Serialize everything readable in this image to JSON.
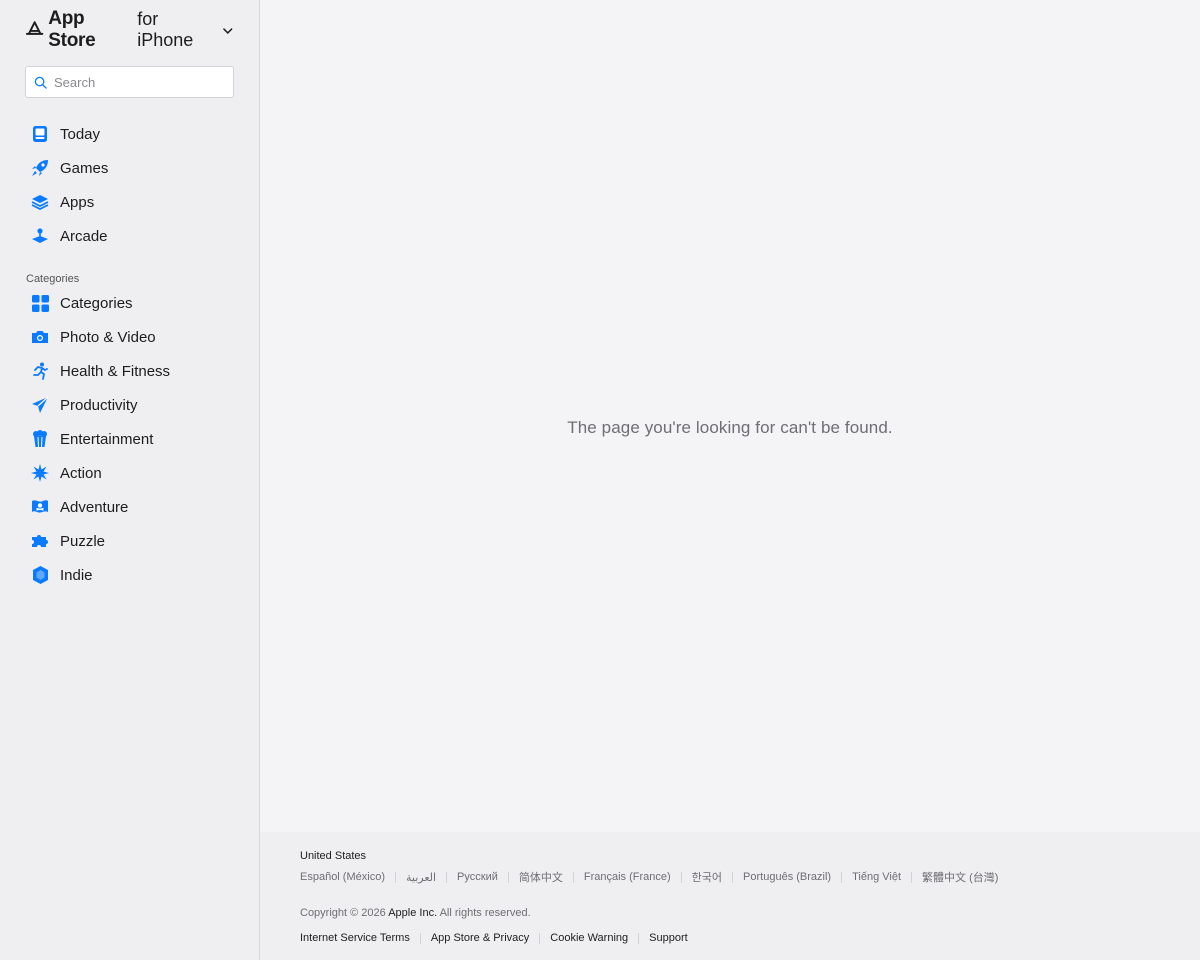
{
  "brand": {
    "name": "App Store",
    "platform": "for iPhone"
  },
  "search": {
    "placeholder": "Search",
    "value": ""
  },
  "nav": [
    {
      "label": "Today",
      "icon": "today-icon"
    },
    {
      "label": "Games",
      "icon": "rocket-icon"
    },
    {
      "label": "Apps",
      "icon": "layers-icon"
    },
    {
      "label": "Arcade",
      "icon": "joystick-icon"
    }
  ],
  "categories": {
    "title": "Categories",
    "items": [
      {
        "label": "Categories",
        "icon": "grid-icon"
      },
      {
        "label": "Photo & Video",
        "icon": "camera-icon"
      },
      {
        "label": "Health & Fitness",
        "icon": "runner-icon"
      },
      {
        "label": "Productivity",
        "icon": "paper-plane-icon"
      },
      {
        "label": "Entertainment",
        "icon": "popcorn-icon"
      },
      {
        "label": "Action",
        "icon": "burst-icon"
      },
      {
        "label": "Adventure",
        "icon": "pirate-flag-icon"
      },
      {
        "label": "Puzzle",
        "icon": "puzzle-icon"
      },
      {
        "label": "Indie",
        "icon": "gem-icon"
      }
    ]
  },
  "main": {
    "message": "The page you're looking for can't be found."
  },
  "footer": {
    "country": "United States",
    "languages": [
      "Español (México)",
      "العربية",
      "Русский",
      "简体中文",
      "Français (France)",
      "한국어",
      "Português (Brazil)",
      "Tiếng Việt",
      "繁體中文 (台灣)"
    ],
    "copyright_prefix": "Copyright © 2026",
    "company": "Apple Inc.",
    "rights": "All rights reserved.",
    "legal": [
      "Internet Service Terms",
      "App Store & Privacy",
      "Cookie Warning",
      "Support"
    ]
  },
  "colors": {
    "accent": "#0a7aff",
    "sidebar_bg": "#efeff1",
    "main_bg": "#f4f4f6",
    "text": "#1d1d1f",
    "muted": "#6e6e73"
  }
}
